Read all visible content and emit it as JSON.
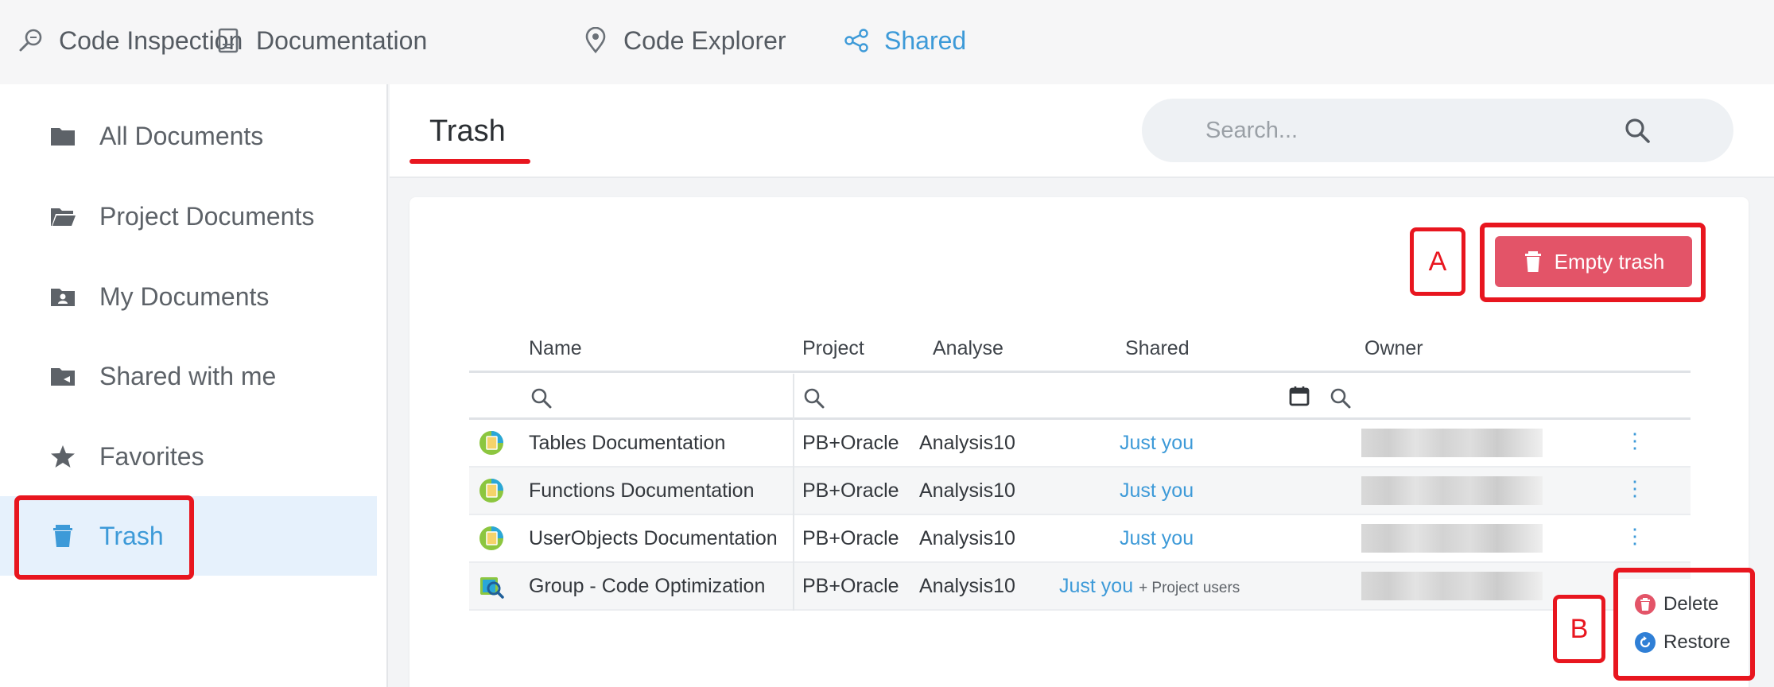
{
  "topnav": {
    "items": [
      {
        "label": "Code Inspection",
        "icon": "magnifier-inspect-icon"
      },
      {
        "label": "Documentation",
        "icon": "document-icon"
      },
      {
        "label": "Code Explorer",
        "icon": "map-pin-icon"
      },
      {
        "label": "Shared",
        "icon": "share-icon",
        "active": true
      }
    ]
  },
  "sidebar": {
    "items": [
      {
        "label": "All Documents",
        "icon": "folder-icon"
      },
      {
        "label": "Project Documents",
        "icon": "folder-open-icon"
      },
      {
        "label": "My Documents",
        "icon": "user-folder-icon"
      },
      {
        "label": "Shared with me",
        "icon": "shared-folder-icon"
      },
      {
        "label": "Favorites",
        "icon": "star-icon"
      },
      {
        "label": "Trash",
        "icon": "trash-icon",
        "active": true
      }
    ]
  },
  "header": {
    "title": "Trash",
    "search_placeholder": "Search..."
  },
  "toolbar": {
    "empty_trash_label": "Empty trash"
  },
  "annotations": {
    "a": "A",
    "b": "B"
  },
  "table": {
    "columns": [
      "Name",
      "Project",
      "Analyse",
      "Shared",
      "Owner"
    ],
    "rows": [
      {
        "name": "Tables Documentation",
        "project": "PB+Oracle",
        "analyse": "Analysis10",
        "shared": "Just you",
        "shared_extra": "",
        "icon": "document-globe-icon"
      },
      {
        "name": "Functions Documentation",
        "project": "PB+Oracle",
        "analyse": "Analysis10",
        "shared": "Just you",
        "shared_extra": "",
        "icon": "document-globe-icon"
      },
      {
        "name": "UserObjects Documentation",
        "project": "PB+Oracle",
        "analyse": "Analysis10",
        "shared": "Just you",
        "shared_extra": "",
        "icon": "document-globe-icon"
      },
      {
        "name": "Group - Code Optimization",
        "project": "PB+Oracle",
        "analyse": "Analysis10",
        "shared": "Just you",
        "shared_extra": "+ Project users",
        "icon": "code-optimization-icon"
      }
    ]
  },
  "context_menu": {
    "delete_label": "Delete",
    "restore_label": "Restore"
  },
  "colors": {
    "accent": "#3d9ad8",
    "annotation_red": "#e8161f",
    "danger_button": "#e35468",
    "active_sidebar_bg": "#e6f1fc"
  }
}
